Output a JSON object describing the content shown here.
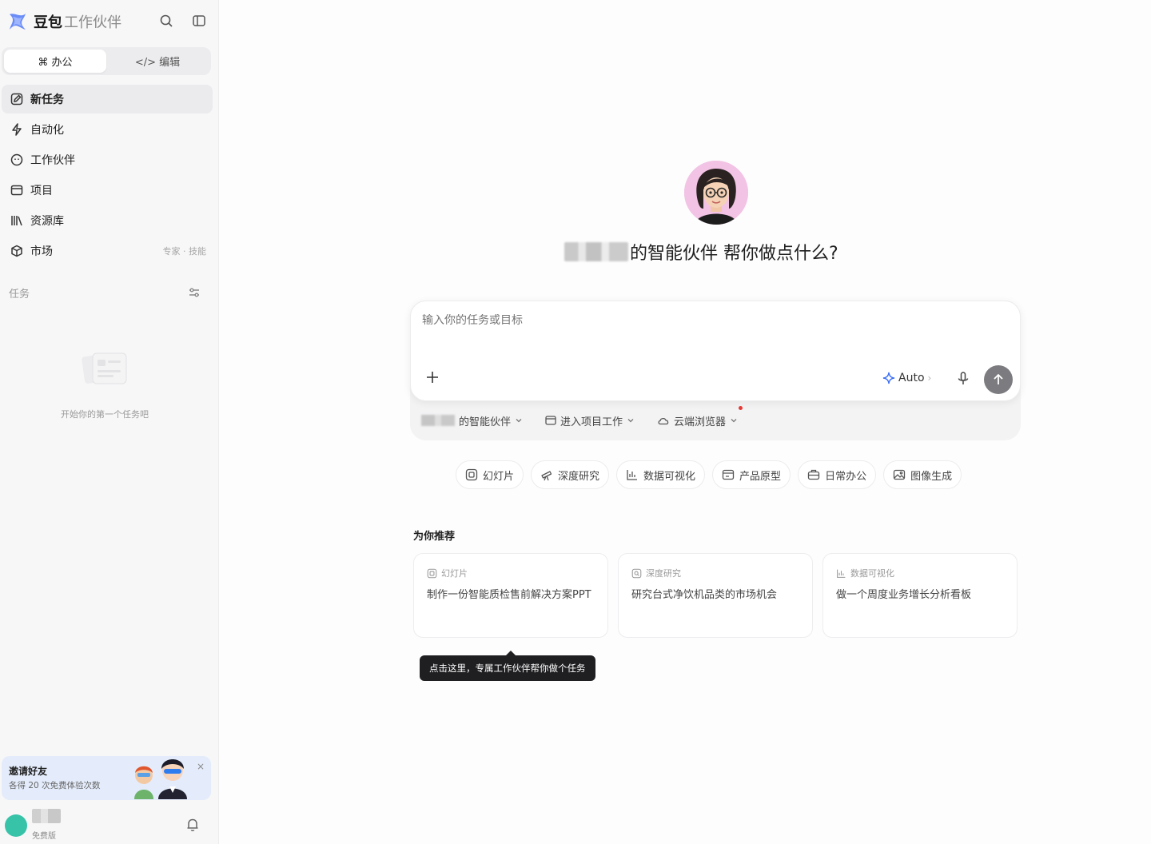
{
  "brand": {
    "name_main": "豆包",
    "name_sub": "工作伙伴"
  },
  "mode_toggle": {
    "office_label": "⌘ 办公",
    "edit_label": "</> 编辑"
  },
  "nav": {
    "items": [
      {
        "label": "新任务",
        "icon": "edit-icon"
      },
      {
        "label": "自动化",
        "icon": "lightning-icon"
      },
      {
        "label": "工作伙伴",
        "icon": "partner-icon"
      },
      {
        "label": "项目",
        "icon": "folder-icon"
      },
      {
        "label": "资源库",
        "icon": "library-icon"
      },
      {
        "label": "市场",
        "icon": "box-icon",
        "hint": "专家 · 技能"
      }
    ]
  },
  "tasks": {
    "section_title": "任务",
    "empty_text": "开始你的第一个任务吧"
  },
  "invite": {
    "title": "邀请好友",
    "subtitle": "各得 20 次免费体验次数",
    "close": "×"
  },
  "user": {
    "plan": "免费版"
  },
  "main": {
    "headline": "的智能伙伴 帮你做点什么?",
    "composer": {
      "placeholder": "输入你的任务或目标",
      "auto_label": "Auto",
      "auto_chevron": "›"
    },
    "chips": [
      {
        "label": "的智能伙伴"
      },
      {
        "label": "进入项目工作"
      },
      {
        "label": "云端浏览器"
      }
    ],
    "tools": [
      {
        "label": "幻灯片"
      },
      {
        "label": "深度研究"
      },
      {
        "label": "数据可视化"
      },
      {
        "label": "产品原型"
      },
      {
        "label": "日常办公"
      },
      {
        "label": "图像生成"
      }
    ],
    "recommend_title": "为你推荐",
    "cards": [
      {
        "category": "幻灯片",
        "text": "制作一份智能质检售前解决方案PPT"
      },
      {
        "category": "深度研究",
        "text": "研究台式净饮机品类的市场机会"
      },
      {
        "category": "数据可视化",
        "text": "做一个周度业务增长分析看板"
      }
    ],
    "tooltip": "点击这里，专属工作伙伴帮你做个任务"
  },
  "colors": {
    "accent": "#3b6ff5",
    "send_button": "#7c7c80",
    "notification_dot": "#e53935",
    "invite_bg": "#e4ecfb"
  }
}
